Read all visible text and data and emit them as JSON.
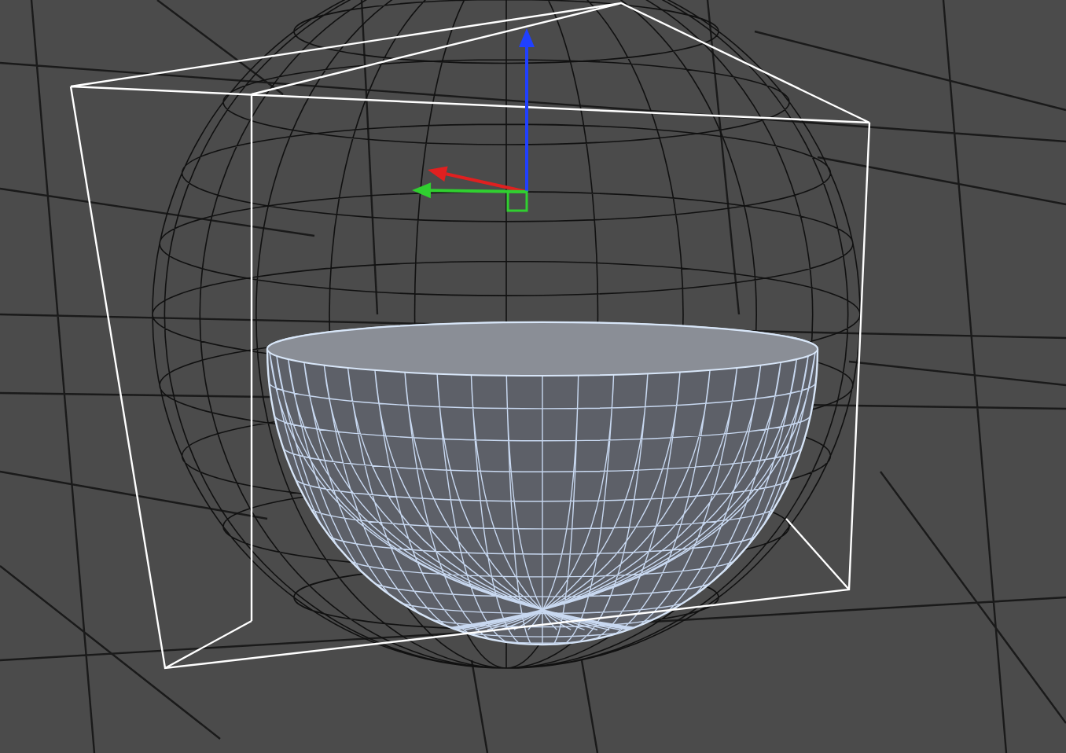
{
  "gizmo": {
    "axes": [
      {
        "color": "#e02020"
      },
      {
        "color": "#30d030"
      },
      {
        "color": "#2040ff"
      }
    ]
  }
}
